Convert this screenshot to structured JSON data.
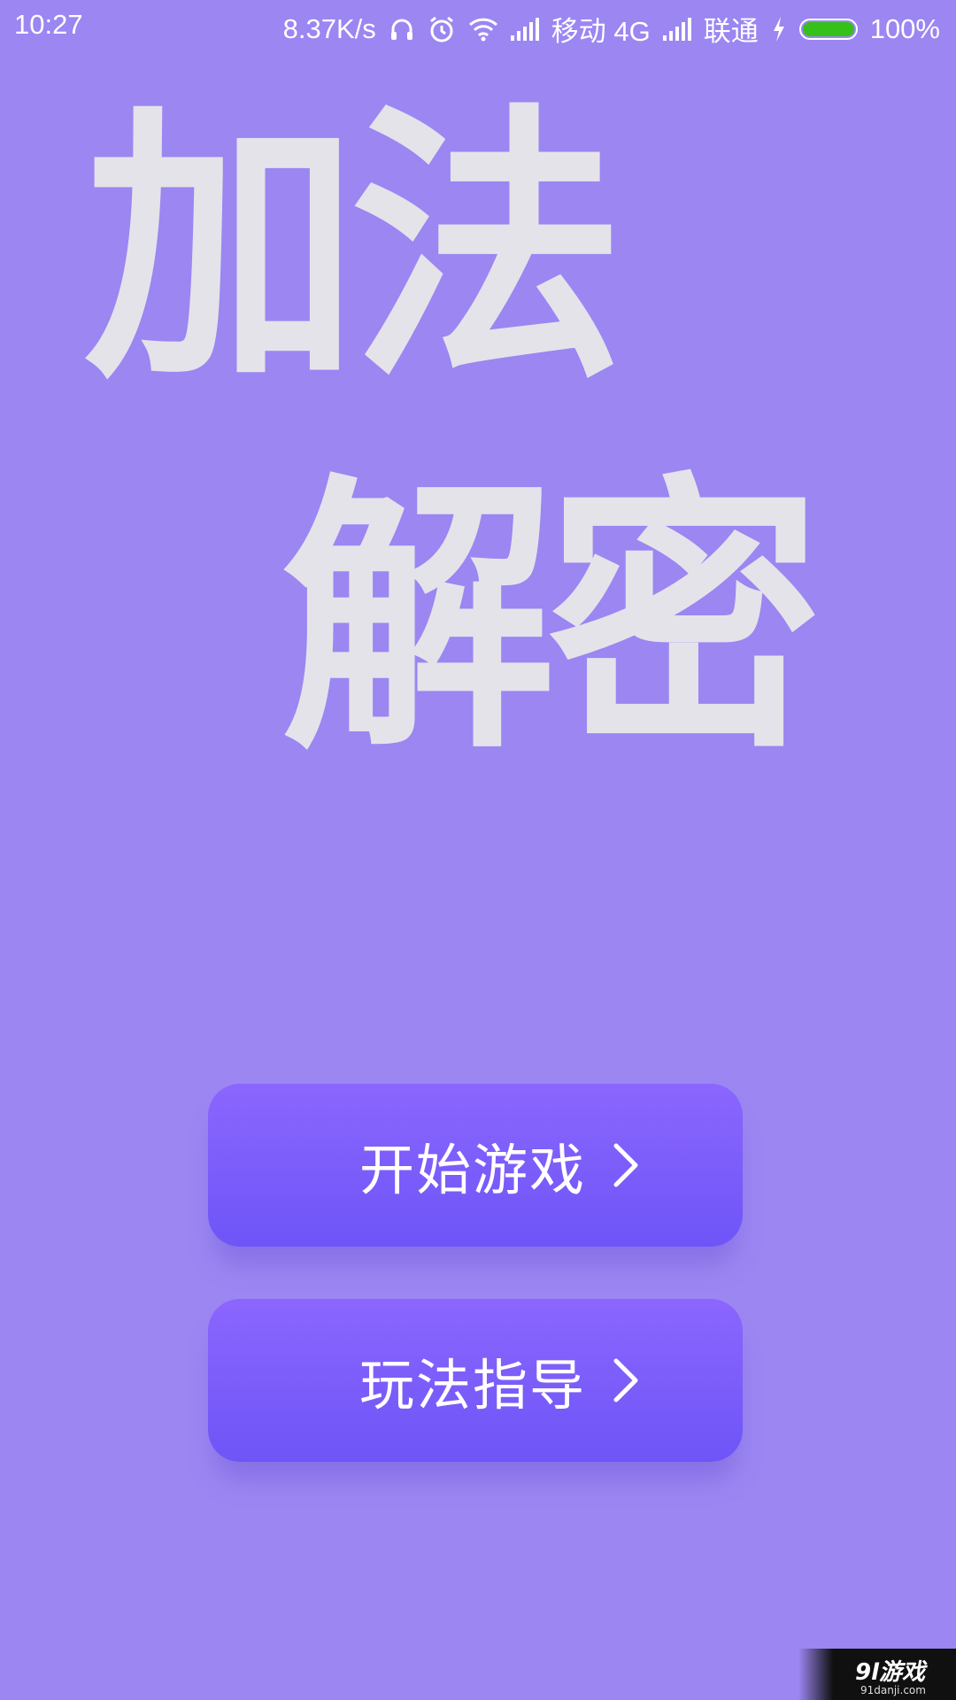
{
  "status_bar": {
    "time": "10:27",
    "net_speed": "8.37K/s",
    "carrier_1": "移动 4G",
    "carrier_2": "联通",
    "battery_text": "100%",
    "battery_level": 1.0,
    "battery_color": "#35c01a",
    "icons": [
      "headset-icon",
      "alarm-icon",
      "wifi-icon",
      "signal-icon",
      "signal-icon",
      "charging-icon",
      "battery-icon"
    ]
  },
  "title": {
    "line1": "加法",
    "line2": "解密",
    "color": "#e4e3ea"
  },
  "menu": {
    "start_label": "开始游戏",
    "guide_label": "玩法指导",
    "chevron_icon": "chevron-right-icon",
    "button_color_top": "#8b66fe",
    "button_color_bottom": "#6e55f7"
  },
  "background_color": "#9b86f2",
  "watermark": {
    "main": "9l游戏",
    "sub": "91danji.com"
  }
}
